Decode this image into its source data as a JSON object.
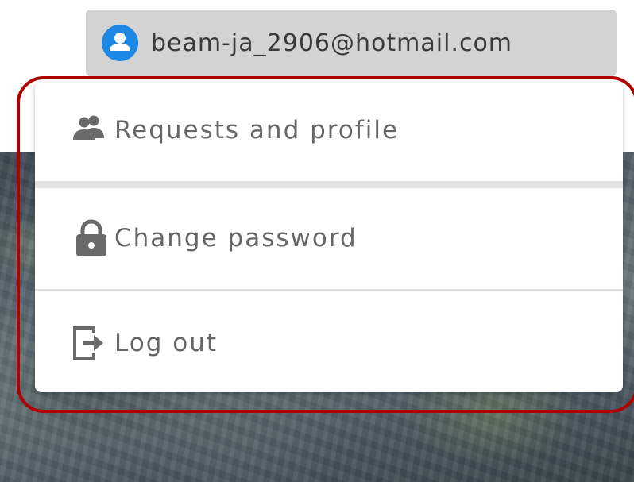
{
  "account": {
    "email": "beam-ja_2906@hotmail.com",
    "avatar_icon": "user-avatar-icon",
    "avatar_color": "#1e88e5"
  },
  "menu": {
    "items": [
      {
        "label": "Requests and profile",
        "icon": "people-icon"
      },
      {
        "label": "Change password",
        "icon": "lock-icon"
      },
      {
        "label": "Log out",
        "icon": "logout-icon"
      }
    ]
  },
  "colors": {
    "highlight": "#b00000",
    "chip_background": "#d3d3d3",
    "menu_text": "#666666"
  }
}
